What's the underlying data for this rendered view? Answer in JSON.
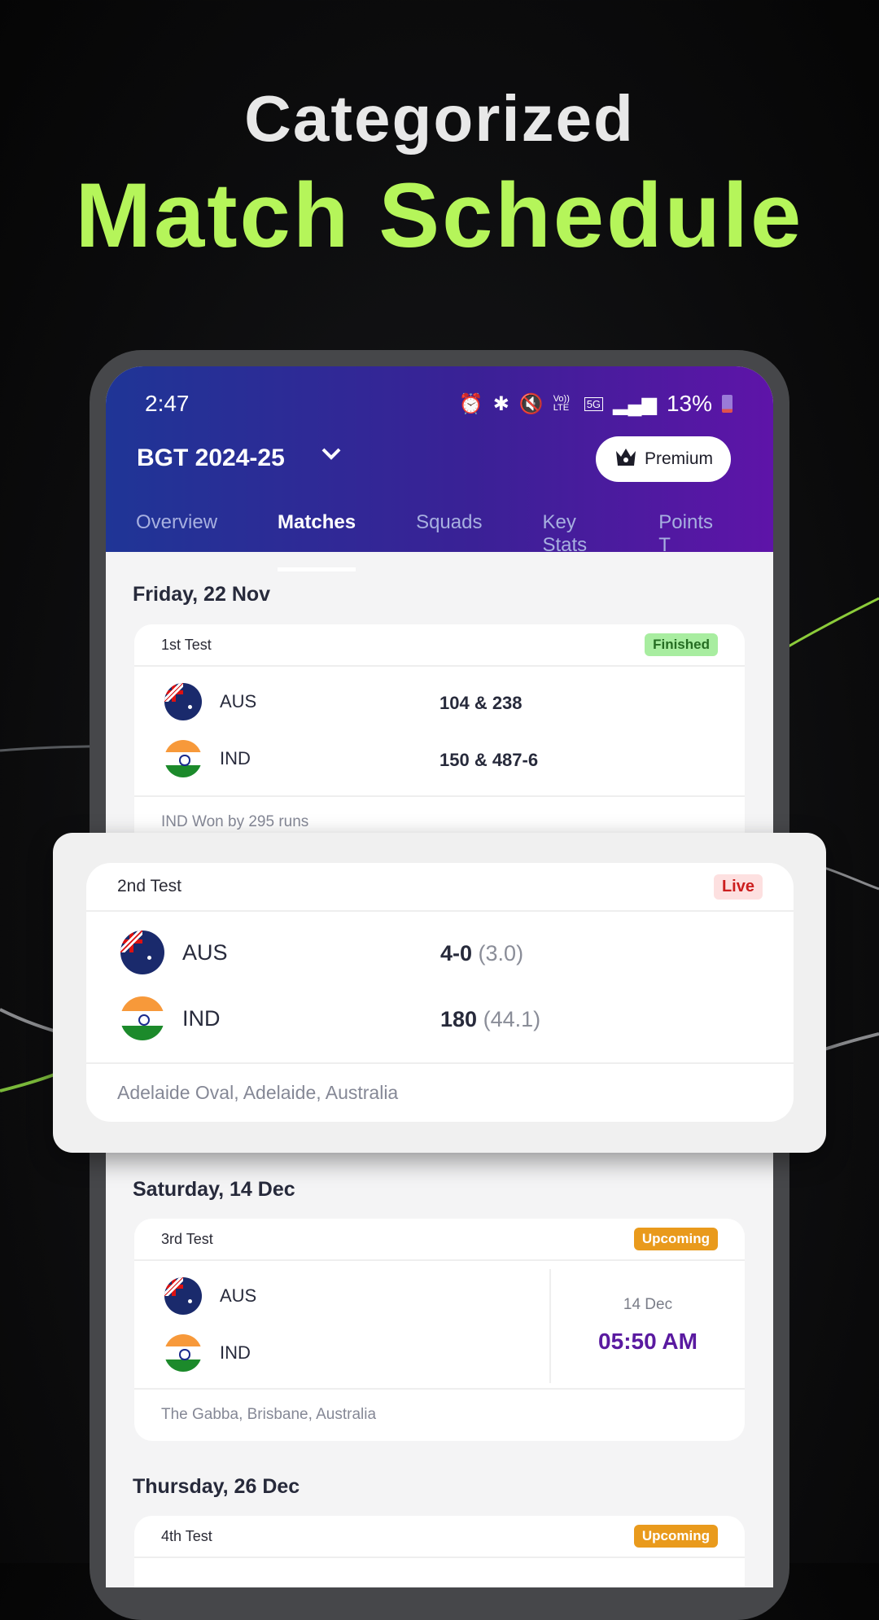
{
  "promo": {
    "line1": "Categorized",
    "line2": "Match Schedule",
    "accent": "#b5f55a"
  },
  "status_bar": {
    "time": "2:47",
    "battery": "13%",
    "icons": [
      "alarm-icon",
      "bluetooth-icon",
      "mute-icon",
      "volte-icon",
      "5g-icon",
      "signal-icon",
      "battery-icon"
    ],
    "volte": "Vo)) LTE",
    "network": "5G"
  },
  "header": {
    "title": "BGT 2024-25",
    "premium_label": "Premium"
  },
  "tabs": [
    {
      "label": "Overview"
    },
    {
      "label": "Matches",
      "active": true
    },
    {
      "label": "Squads"
    },
    {
      "label": "Key Stats"
    },
    {
      "label": "Points T"
    }
  ],
  "groups": [
    {
      "date": "Friday, 22 Nov",
      "match": {
        "name": "1st Test",
        "status": "Finished",
        "teams": [
          {
            "code": "AUS",
            "score": "104 & 238"
          },
          {
            "code": "IND",
            "score": "150 & 487-6"
          }
        ],
        "footer": "IND Won by 295 runs"
      }
    },
    {
      "match": {
        "name": "2nd Test",
        "status": "Live",
        "teams": [
          {
            "code": "AUS",
            "score": "4-0",
            "overs": "(3.0)"
          },
          {
            "code": "IND",
            "score": "180",
            "overs": "(44.1)"
          }
        ],
        "footer": "Adelaide Oval, Adelaide, Australia"
      }
    },
    {
      "date": "Saturday, 14 Dec",
      "match": {
        "name": "3rd Test",
        "status": "Upcoming",
        "teams": [
          {
            "code": "AUS"
          },
          {
            "code": "IND"
          }
        ],
        "day": "14 Dec",
        "time": "05:50 AM",
        "footer": "The Gabba, Brisbane, Australia"
      }
    },
    {
      "date": "Thursday, 26 Dec",
      "match": {
        "name": "4th Test",
        "status": "Upcoming"
      }
    }
  ]
}
